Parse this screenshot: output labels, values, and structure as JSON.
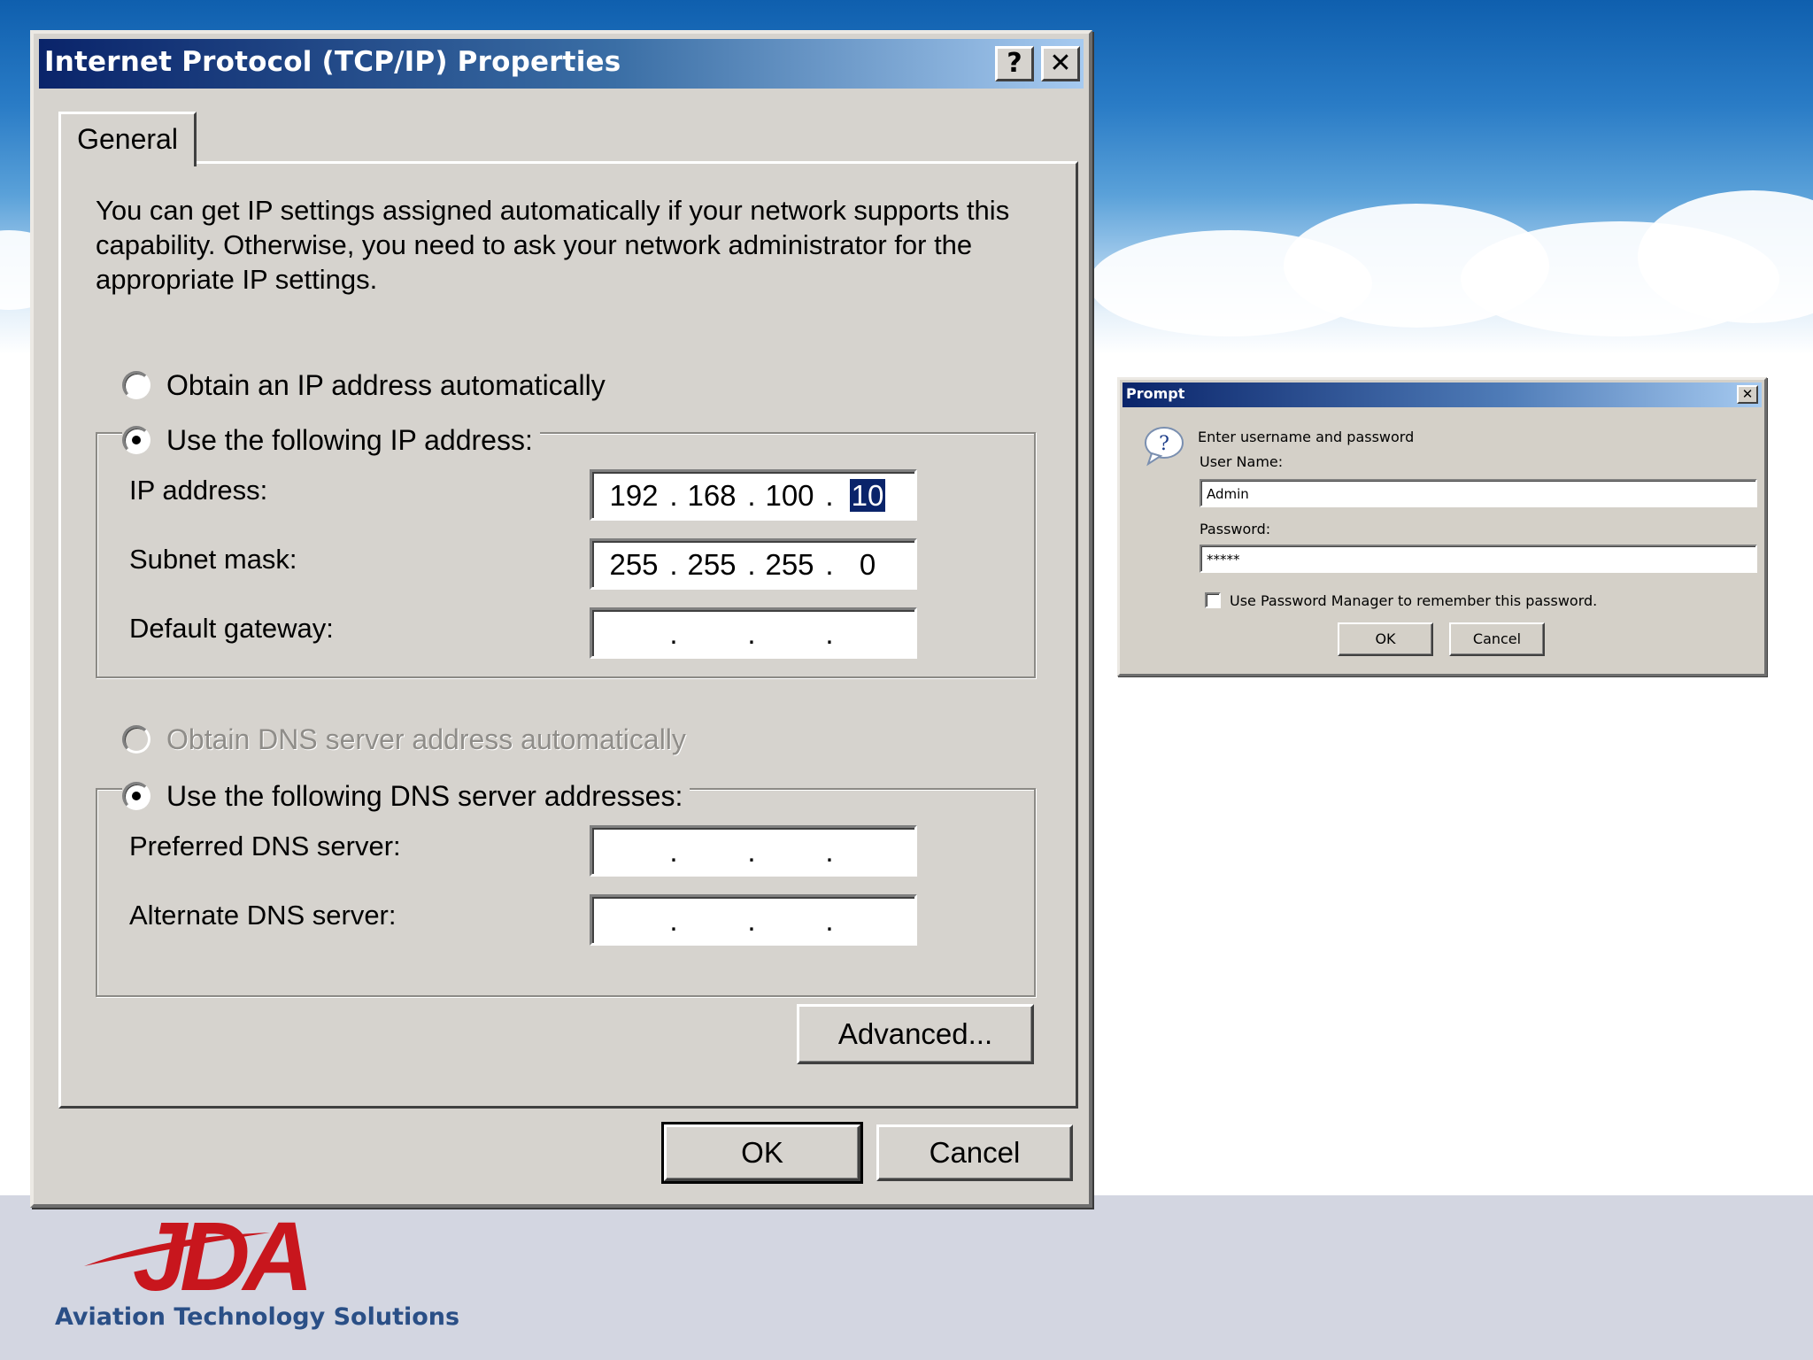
{
  "tcpip_dialog": {
    "title": "Internet Protocol (TCP/IP) Properties",
    "help_button": "?",
    "close_button": "✕",
    "tab_general": "General",
    "description": "You can get IP settings assigned automatically if your network supports this capability. Otherwise, you need to ask your network administrator for the appropriate IP settings.",
    "radio_obtain_ip": "Obtain an IP address automatically",
    "radio_use_ip": "Use the following IP address:",
    "ip_address_label": "IP address:",
    "ip_address": [
      "192",
      "168",
      "100",
      "10"
    ],
    "subnet_mask_label": "Subnet mask:",
    "subnet_mask": [
      "255",
      "255",
      "255",
      "0"
    ],
    "default_gateway_label": "Default gateway:",
    "default_gateway": [
      "",
      "",
      "",
      ""
    ],
    "radio_obtain_dns": "Obtain DNS server address automatically",
    "radio_use_dns": "Use the following DNS server addresses:",
    "preferred_dns_label": "Preferred DNS server:",
    "preferred_dns": [
      "",
      "",
      "",
      ""
    ],
    "alternate_dns_label": "Alternate DNS server:",
    "alternate_dns": [
      "",
      "",
      "",
      ""
    ],
    "advanced_button": "Advanced...",
    "ok_button": "OK",
    "cancel_button": "Cancel"
  },
  "prompt_dialog": {
    "title": "Prompt",
    "close_button": "✕",
    "message": "Enter username and password",
    "username_label": "User Name:",
    "username_value": "Admin",
    "password_label": "Password:",
    "password_value": "*****",
    "remember_label": "Use Password Manager to remember this password.",
    "remember_checked": false,
    "ok_button": "OK",
    "cancel_button": "Cancel"
  },
  "branding": {
    "logo_text": "JDA",
    "tagline": "Aviation Technology Solutions",
    "logo_color": "#c8161d",
    "tagline_color": "#2a4f86"
  },
  "colors": {
    "dialog_face": "#d6d3ce",
    "titlebar_start": "#0a246a",
    "titlebar_end": "#a6caf0",
    "selection": "#0a246a",
    "footer_band": "#d3d6e1"
  }
}
